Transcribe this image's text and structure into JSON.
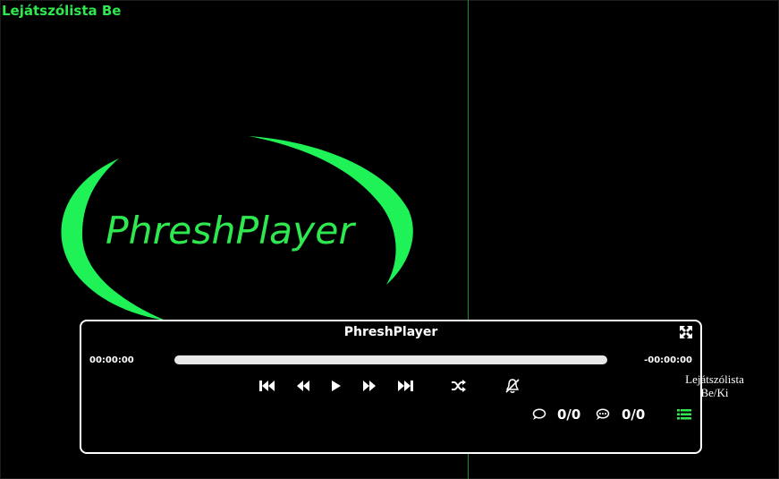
{
  "header": {
    "playlist_toggle_label": "Lejátszólista Be"
  },
  "logo": {
    "text": "PhreshPlayer",
    "color": "#1ff256"
  },
  "player": {
    "title": "PhreshPlayer",
    "time_elapsed": "00:00:00",
    "time_remaining": "-00:00:00",
    "progress": 0,
    "subtitles_count": "0/0",
    "comments_count": "0/0"
  },
  "tooltip": {
    "text": "Lejátszólista Be/Ki"
  },
  "colors": {
    "accent": "#2ee84f",
    "background": "#000000",
    "panel_border": "#ffffff"
  }
}
